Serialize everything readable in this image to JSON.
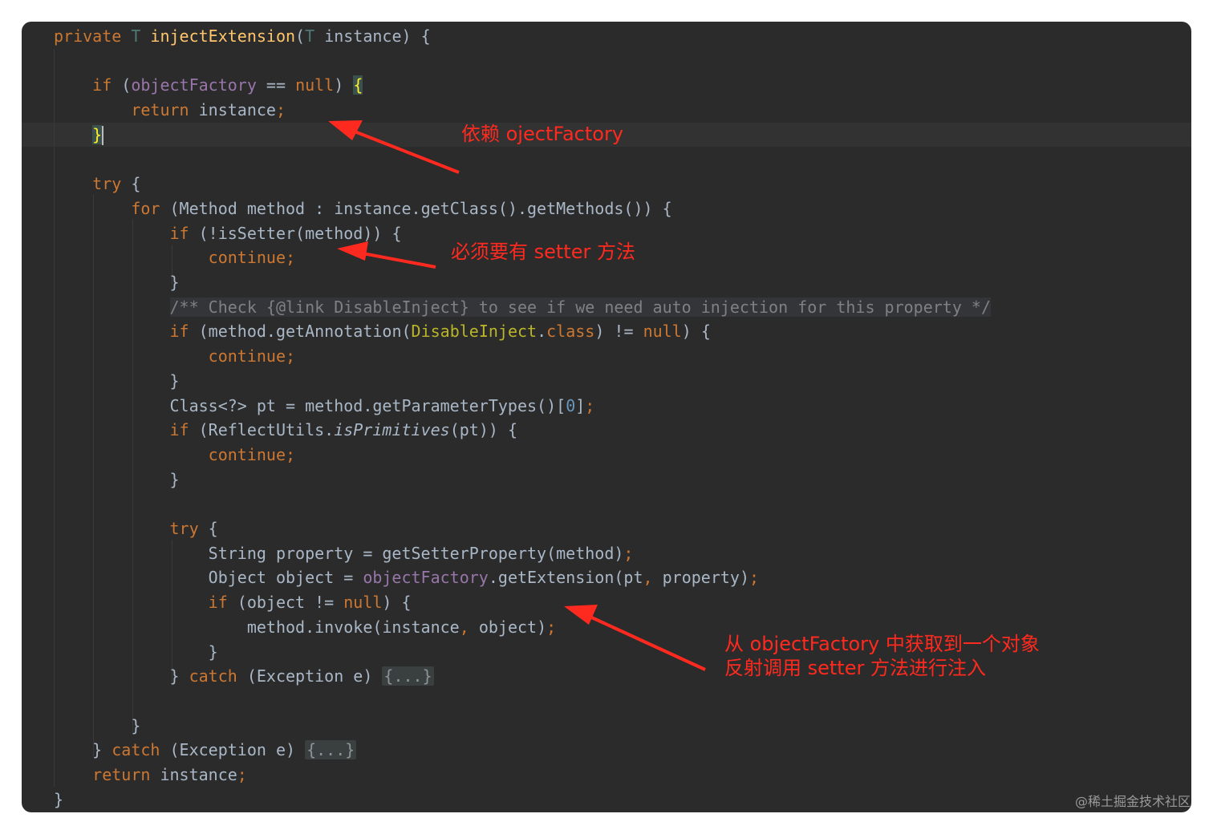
{
  "editor": {
    "lines": [
      [
        {
          "t": "private ",
          "c": "kw"
        },
        {
          "t": "T ",
          "c": "tp"
        },
        {
          "t": "injectExtension",
          "c": "fn"
        },
        {
          "t": "(",
          "c": ""
        },
        {
          "t": "T ",
          "c": "tp"
        },
        {
          "t": "instance) {",
          "c": ""
        }
      ],
      [],
      [
        {
          "t": "    ",
          "c": ""
        },
        {
          "t": "if ",
          "c": "kw"
        },
        {
          "t": "(",
          "c": ""
        },
        {
          "t": "objectFactory",
          "c": "fld"
        },
        {
          "t": " == ",
          "c": ""
        },
        {
          "t": "null",
          "c": "kw"
        },
        {
          "t": ") ",
          "c": ""
        },
        {
          "t": "{",
          "c": "brace-hl"
        }
      ],
      [
        {
          "t": "        ",
          "c": ""
        },
        {
          "t": "return ",
          "c": "kw"
        },
        {
          "t": "instance",
          "c": ""
        },
        {
          "t": ";",
          "c": "kw"
        }
      ],
      [
        {
          "t": "    ",
          "c": ""
        },
        {
          "t": "}",
          "c": "brace-hl"
        },
        {
          "t": "",
          "c": "caret"
        }
      ],
      [],
      [
        {
          "t": "    ",
          "c": ""
        },
        {
          "t": "try ",
          "c": "kw"
        },
        {
          "t": "{",
          "c": ""
        }
      ],
      [
        {
          "t": "        ",
          "c": ""
        },
        {
          "t": "for ",
          "c": "kw"
        },
        {
          "t": "(Method method : instance.getClass().getMethods()) {",
          "c": ""
        }
      ],
      [
        {
          "t": "            ",
          "c": ""
        },
        {
          "t": "if ",
          "c": "kw"
        },
        {
          "t": "(!isSetter(method)) {",
          "c": ""
        }
      ],
      [
        {
          "t": "                ",
          "c": ""
        },
        {
          "t": "continue",
          "c": "kw"
        },
        {
          "t": ";",
          "c": "kw"
        }
      ],
      [
        {
          "t": "            }",
          "c": ""
        }
      ],
      [
        {
          "t": "            ",
          "c": ""
        },
        {
          "t": "/** Check {@link DisableInject} to see if we need auto injection for this property */",
          "c": "cmt cmt-bg"
        }
      ],
      [
        {
          "t": "            ",
          "c": ""
        },
        {
          "t": "if ",
          "c": "kw"
        },
        {
          "t": "(method.getAnnotation(",
          "c": ""
        },
        {
          "t": "DisableInject",
          "c": "ann"
        },
        {
          "t": ".",
          "c": ""
        },
        {
          "t": "class",
          "c": "kw"
        },
        {
          "t": ") != ",
          "c": ""
        },
        {
          "t": "null",
          "c": "kw"
        },
        {
          "t": ") {",
          "c": ""
        }
      ],
      [
        {
          "t": "                ",
          "c": ""
        },
        {
          "t": "continue",
          "c": "kw"
        },
        {
          "t": ";",
          "c": "kw"
        }
      ],
      [
        {
          "t": "            }",
          "c": ""
        }
      ],
      [
        {
          "t": "            Class<?> pt = method.getParameterTypes()[",
          "c": ""
        },
        {
          "t": "0",
          "c": "num"
        },
        {
          "t": "]",
          "c": ""
        },
        {
          "t": ";",
          "c": "kw"
        }
      ],
      [
        {
          "t": "            ",
          "c": ""
        },
        {
          "t": "if ",
          "c": "kw"
        },
        {
          "t": "(ReflectUtils.",
          "c": ""
        },
        {
          "t": "isPrimitives",
          "c": "it"
        },
        {
          "t": "(pt)) {",
          "c": ""
        }
      ],
      [
        {
          "t": "                ",
          "c": ""
        },
        {
          "t": "continue",
          "c": "kw"
        },
        {
          "t": ";",
          "c": "kw"
        }
      ],
      [
        {
          "t": "            }",
          "c": ""
        }
      ],
      [],
      [
        {
          "t": "            ",
          "c": ""
        },
        {
          "t": "try ",
          "c": "kw"
        },
        {
          "t": "{",
          "c": ""
        }
      ],
      [
        {
          "t": "                String property = getSetterProperty(method)",
          "c": ""
        },
        {
          "t": ";",
          "c": "kw"
        }
      ],
      [
        {
          "t": "                Object object = ",
          "c": ""
        },
        {
          "t": "objectFactory",
          "c": "fld"
        },
        {
          "t": ".getExtension(pt",
          "c": ""
        },
        {
          "t": ", ",
          "c": "kw"
        },
        {
          "t": "property)",
          "c": ""
        },
        {
          "t": ";",
          "c": "kw"
        }
      ],
      [
        {
          "t": "                ",
          "c": ""
        },
        {
          "t": "if ",
          "c": "kw"
        },
        {
          "t": "(object != ",
          "c": ""
        },
        {
          "t": "null",
          "c": "kw"
        },
        {
          "t": ") {",
          "c": ""
        }
      ],
      [
        {
          "t": "                    method.invoke(instance",
          "c": ""
        },
        {
          "t": ", ",
          "c": "kw"
        },
        {
          "t": "object)",
          "c": ""
        },
        {
          "t": ";",
          "c": "kw"
        }
      ],
      [
        {
          "t": "                }",
          "c": ""
        }
      ],
      [
        {
          "t": "            } ",
          "c": ""
        },
        {
          "t": "catch ",
          "c": "kw"
        },
        {
          "t": "(Exception e) ",
          "c": ""
        },
        {
          "t": "{...}",
          "c": "fold"
        }
      ],
      [],
      [
        {
          "t": "        }",
          "c": ""
        }
      ],
      [
        {
          "t": "    } ",
          "c": ""
        },
        {
          "t": "catch ",
          "c": "kw"
        },
        {
          "t": "(Exception e) ",
          "c": ""
        },
        {
          "t": "{...}",
          "c": "fold"
        }
      ],
      [
        {
          "t": "    ",
          "c": ""
        },
        {
          "t": "return ",
          "c": "kw"
        },
        {
          "t": "instance",
          "c": ""
        },
        {
          "t": ";",
          "c": "kw"
        }
      ],
      [
        {
          "t": "}",
          "c": ""
        }
      ]
    ]
  },
  "annotations": {
    "note1": "依赖 ojectFactory",
    "note2": "必须要有 setter 方法",
    "note3_line1": "从 objectFactory 中获取到一个对象",
    "note3_line2": "反射调用 setter 方法进行注入"
  },
  "watermark": "@稀土掘金技术社区",
  "colors": {
    "background": "#2b2b2b",
    "keyword": "#cc7832",
    "method": "#ffc66d",
    "field": "#9876aa",
    "comment": "#808080",
    "annotation_red": "#ff2a1f"
  }
}
